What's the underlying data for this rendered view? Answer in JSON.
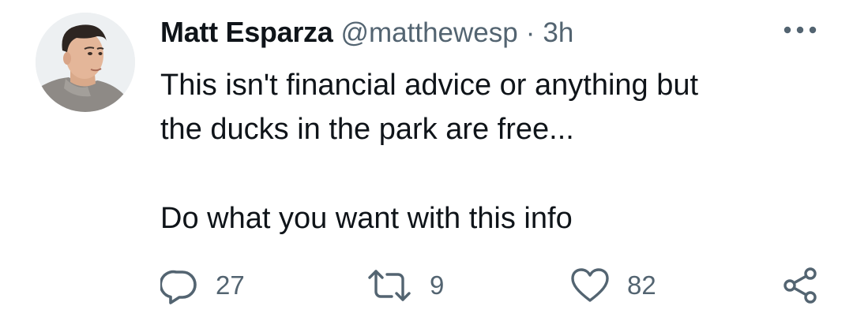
{
  "tweet": {
    "display_name": "Matt Esparza",
    "handle": "@matthewesp",
    "separator": "·",
    "time": "3h",
    "body_lines": [
      "This isn't financial advice or anything but",
      "the ducks in the park are free..."
    ],
    "body_line_3": "Do what you want with this info",
    "actions": {
      "reply_count": "27",
      "retweet_count": "9",
      "like_count": "82"
    },
    "icons": {
      "avatar": "profile-photo",
      "more": "more-dots-icon",
      "reply": "reply-icon",
      "retweet": "retweet-icon",
      "like": "heart-icon",
      "share": "share-icon"
    },
    "colors": {
      "text": "#0f1419",
      "secondary": "#536471",
      "background": "#ffffff"
    }
  }
}
